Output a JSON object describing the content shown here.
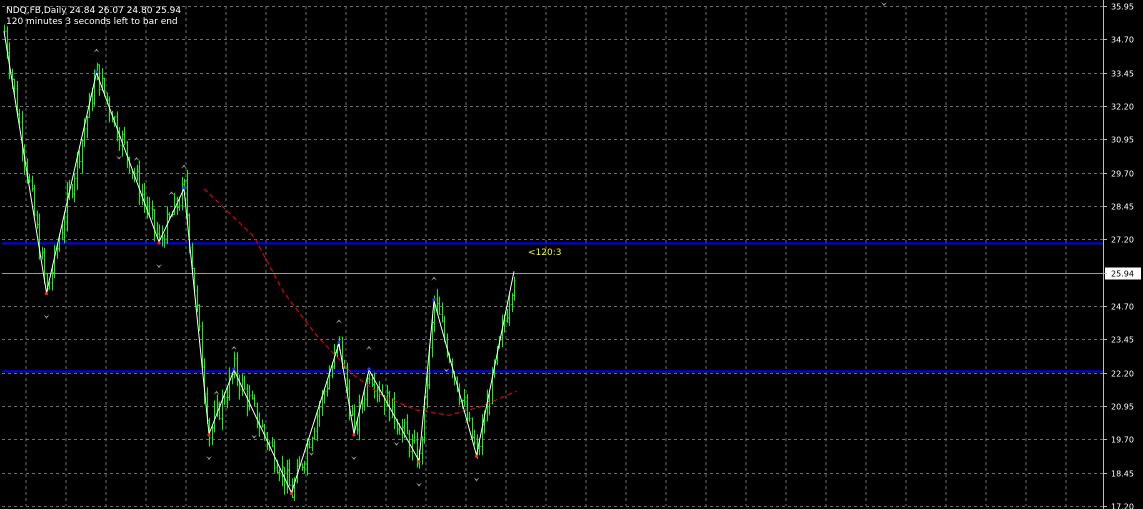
{
  "header": {
    "symbol_line": "NDQ,FB,Daily  24.84 26.07 24.80 25.94",
    "timer_line": "120 minutes 3 seconds left to bar end"
  },
  "countdown_label": "<120:3",
  "current_price_label": "25.94",
  "colors": {
    "background": "#000000",
    "grid": "#6e6e6e",
    "candle": "#00ff00",
    "zigzag": "#ffffff",
    "hline": "#0000ff",
    "ma": "#ff0000",
    "countdown": "#ffff00",
    "arrows": "#9a9a9a"
  },
  "chart_data": {
    "type": "line",
    "y_ticks": [
      "35.95",
      "34.70",
      "33.45",
      "32.20",
      "30.95",
      "29.70",
      "28.45",
      "27.20",
      "25.94",
      "24.70",
      "23.45",
      "22.20",
      "20.95",
      "19.70",
      "18.45",
      "17.20"
    ],
    "ylim": [
      17.2,
      35.95
    ],
    "grid": true,
    "current_price": 25.94,
    "horizontal_lines": [
      27.05,
      22.25
    ],
    "zigzag": [
      {
        "bar": 0,
        "price": 35.0
      },
      {
        "bar": 17,
        "price": 25.2
      },
      {
        "bar": 37,
        "price": 33.45
      },
      {
        "bar": 62,
        "price": 27.1
      },
      {
        "bar": 72,
        "price": 29.1
      },
      {
        "bar": 82,
        "price": 19.9
      },
      {
        "bar": 92,
        "price": 22.3
      },
      {
        "bar": 115,
        "price": 17.7
      },
      {
        "bar": 134,
        "price": 23.3
      },
      {
        "bar": 140,
        "price": 19.9
      },
      {
        "bar": 146,
        "price": 22.3
      },
      {
        "bar": 166,
        "price": 18.9
      },
      {
        "bar": 172,
        "price": 24.9
      },
      {
        "bar": 189,
        "price": 19.1
      },
      {
        "bar": 204,
        "price": 26.0
      }
    ],
    "ma_curve": [
      {
        "bar": 80,
        "price": 29.1
      },
      {
        "bar": 100,
        "price": 27.3
      },
      {
        "bar": 112,
        "price": 25.2
      },
      {
        "bar": 125,
        "price": 23.6
      },
      {
        "bar": 140,
        "price": 22.1
      },
      {
        "bar": 152,
        "price": 21.3
      },
      {
        "bar": 165,
        "price": 20.8
      },
      {
        "bar": 178,
        "price": 20.6
      },
      {
        "bar": 190,
        "price": 20.9
      },
      {
        "bar": 205,
        "price": 21.5
      }
    ],
    "up_arrow_bars": [
      37,
      53,
      67,
      72,
      85,
      92,
      134,
      146,
      172
    ],
    "down_arrow_bars": [
      17,
      46,
      62,
      82,
      100,
      115,
      123,
      140,
      157,
      166,
      177,
      189
    ]
  }
}
